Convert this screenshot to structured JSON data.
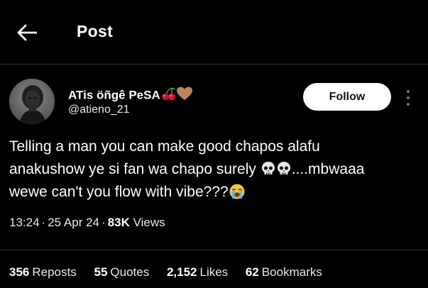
{
  "header": {
    "title": "Post",
    "back_icon": "arrow-left-icon"
  },
  "author": {
    "display_name": "ATis öñgê PeSA",
    "name_emojis": [
      "cherries-emoji",
      "brown-heart-emoji"
    ],
    "handle": "@atieno_21",
    "avatar": "profile-photo"
  },
  "follow_button": {
    "label": "Follow"
  },
  "more_icon": "more-vertical-icon",
  "tweet": {
    "line1": "Telling a man you can make good chapos alafu",
    "line2": "anakushow ye si fan wa chapo surely",
    "line2_emojis": [
      "skull-emoji",
      "skull-emoji"
    ],
    "line2_end": "....mbwaaa",
    "line3": "wewe can't you flow with vibe???",
    "line3_emoji": "loudly-crying-face-emoji"
  },
  "meta": {
    "time": "13:24",
    "separator": "·",
    "date": "25 Apr 24",
    "views_count": "83K",
    "views_label": "Views"
  },
  "stats": [
    {
      "count": "356",
      "label": "Reposts"
    },
    {
      "count": "55",
      "label": "Quotes"
    },
    {
      "count": "2,152",
      "label": "Likes"
    },
    {
      "count": "62",
      "label": "Bookmarks"
    }
  ],
  "colors": {
    "background": "#000000",
    "text": "#e7e9ea",
    "divider": "#2f3336",
    "button_bg": "#ffffff",
    "button_text": "#0f1419",
    "muted": "#71767b"
  }
}
